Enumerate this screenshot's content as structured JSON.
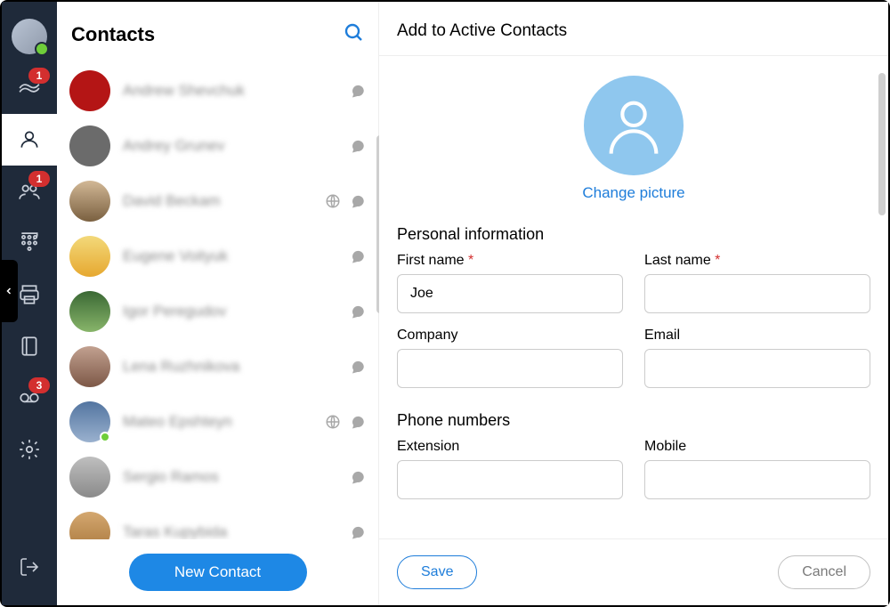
{
  "sidebar": {
    "nav": [
      {
        "name": "hands-icon",
        "badge": "1"
      },
      {
        "name": "contact-icon",
        "active": true
      },
      {
        "name": "group-icon",
        "badge": "1"
      },
      {
        "name": "dialpad-icon"
      },
      {
        "name": "printer-icon"
      },
      {
        "name": "book-icon"
      },
      {
        "name": "voicemail-icon",
        "badge": "3"
      },
      {
        "name": "settings-icon"
      }
    ]
  },
  "contactsPanel": {
    "title": "Contacts",
    "newContactLabel": "New Contact",
    "list": [
      {
        "name": "Andrew Shevchuk",
        "avatarClass": "dev",
        "chat": true
      },
      {
        "name": "Andrey Grunev",
        "avatarClass": "cat",
        "chat": true
      },
      {
        "name": "David Beckam",
        "avatarClass": "man",
        "chat": true,
        "globe": true
      },
      {
        "name": "Eugene Voityuk",
        "avatarClass": "anime",
        "chat": true
      },
      {
        "name": "Igor Peregudov",
        "avatarClass": "ph1",
        "chat": true
      },
      {
        "name": "Lena Ruzhnikova",
        "avatarClass": "ph2",
        "chat": true
      },
      {
        "name": "Mateo Epshteyn",
        "avatarClass": "ph3",
        "chat": true,
        "globe": true,
        "presence": true
      },
      {
        "name": "Sergio Ramos",
        "avatarClass": "ph4",
        "chat": true
      },
      {
        "name": "Taras Kupybida",
        "avatarClass": "ph5",
        "chat": true
      }
    ]
  },
  "detail": {
    "title": "Add to Active Contacts",
    "changePictureLabel": "Change picture",
    "sections": {
      "personal": {
        "title": "Personal information",
        "fields": {
          "firstName": {
            "label": "First name",
            "required": true,
            "value": "Joe"
          },
          "lastName": {
            "label": "Last name",
            "required": true,
            "value": ""
          },
          "company": {
            "label": "Company",
            "value": ""
          },
          "email": {
            "label": "Email",
            "value": ""
          }
        }
      },
      "phone": {
        "title": "Phone numbers",
        "fields": {
          "extension": {
            "label": "Extension",
            "value": ""
          },
          "mobile": {
            "label": "Mobile",
            "value": ""
          }
        }
      }
    },
    "buttons": {
      "save": "Save",
      "cancel": "Cancel"
    }
  }
}
